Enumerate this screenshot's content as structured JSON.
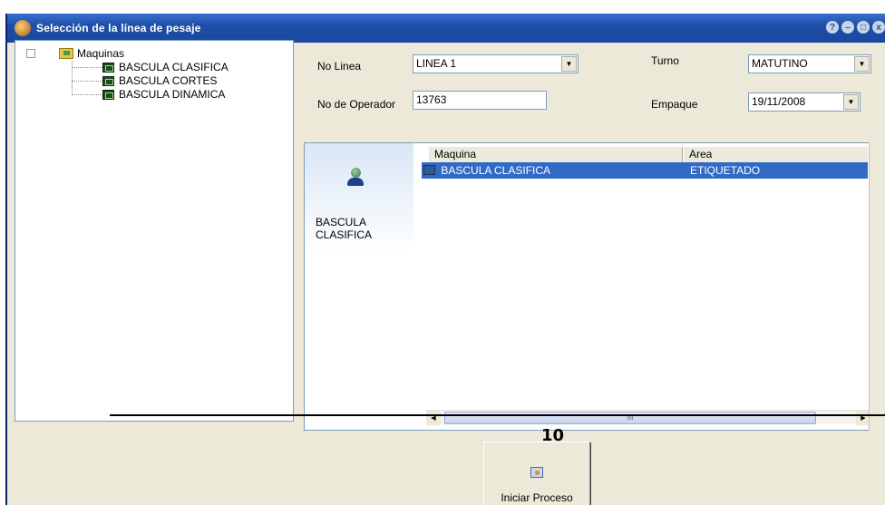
{
  "window": {
    "title": "Selección de la línea de pesaje",
    "buttons": [
      "?",
      "–",
      "□",
      "x"
    ]
  },
  "tree": {
    "root_label": "Maquinas",
    "children": [
      "BASCULA CLASIFICA",
      "BASCULA CORTES",
      "BASCULA DINAMICA"
    ]
  },
  "form": {
    "linea_label": "No Linea",
    "linea_value": "LINEA 1",
    "turno_label": "Turno",
    "turno_value": "MATUTINO",
    "operador_label": "No de Operador",
    "operador_value": "13763",
    "empaque_label": "Empaque",
    "empaque_value": "19/11/2008"
  },
  "list": {
    "card_text_line1": "BASCULA",
    "card_text_line2": "CLASIFICA",
    "columns": [
      "Maquina",
      "Area"
    ],
    "rows": [
      {
        "maquina": "BASCULA CLASIFICA",
        "area": "ETIQUETADO"
      }
    ],
    "scroll_thumb": "III"
  },
  "annotation": {
    "number": "10"
  },
  "start_button": {
    "label": "Iniciar Proceso"
  }
}
